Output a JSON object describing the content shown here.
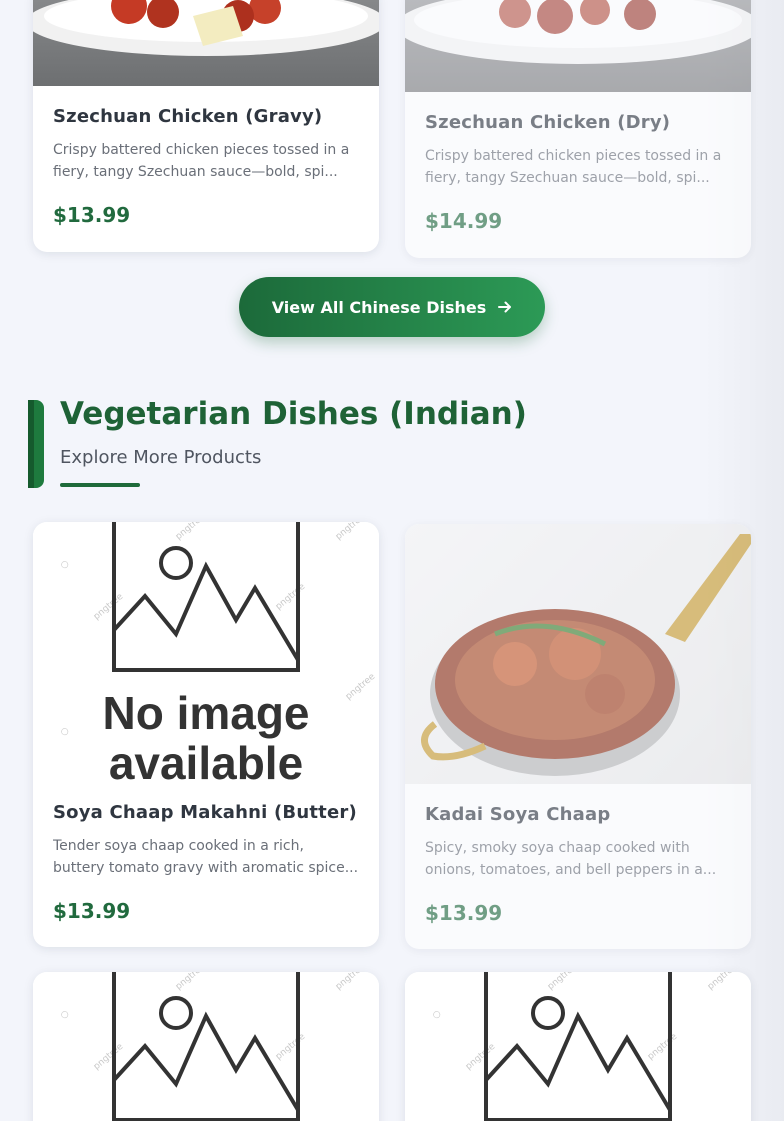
{
  "chinese_section": {
    "cards": [
      {
        "name": "Szechuan Chicken (Gravy)",
        "description": "Crispy battered chicken pieces tossed in a fiery, tangy Szechuan sauce—bold, spi...",
        "price": "$13.99"
      },
      {
        "name": "Szechuan Chicken (Dry)",
        "description": "Crispy battered chicken pieces tossed in a fiery, tangy Szechuan sauce—bold, spi...",
        "price": "$14.99"
      }
    ],
    "view_all_label": "View All Chinese Dishes"
  },
  "veg_section": {
    "title": "Vegetarian Dishes (Indian)",
    "subtitle": "Explore More Products",
    "cards": [
      {
        "name": "Soya Chaap Makahni (Butter)",
        "description": "Tender soya chaap cooked in a rich, buttery tomato gravy with aromatic spice...",
        "price": "$13.99",
        "image_text_1": "No image",
        "image_text_2": "available"
      },
      {
        "name": "Kadai Soya Chaap",
        "description": "Spicy, smoky soya chaap cooked with onions, tomatoes, and bell peppers in a...",
        "price": "$13.99"
      }
    ]
  },
  "colors": {
    "accent": "#216a3e",
    "button_start": "#1c6a3a",
    "button_end": "#2c9a56"
  },
  "icons": {
    "button_icon": "arrow-right-icon",
    "placeholder_icon": "image-placeholder-icon"
  }
}
